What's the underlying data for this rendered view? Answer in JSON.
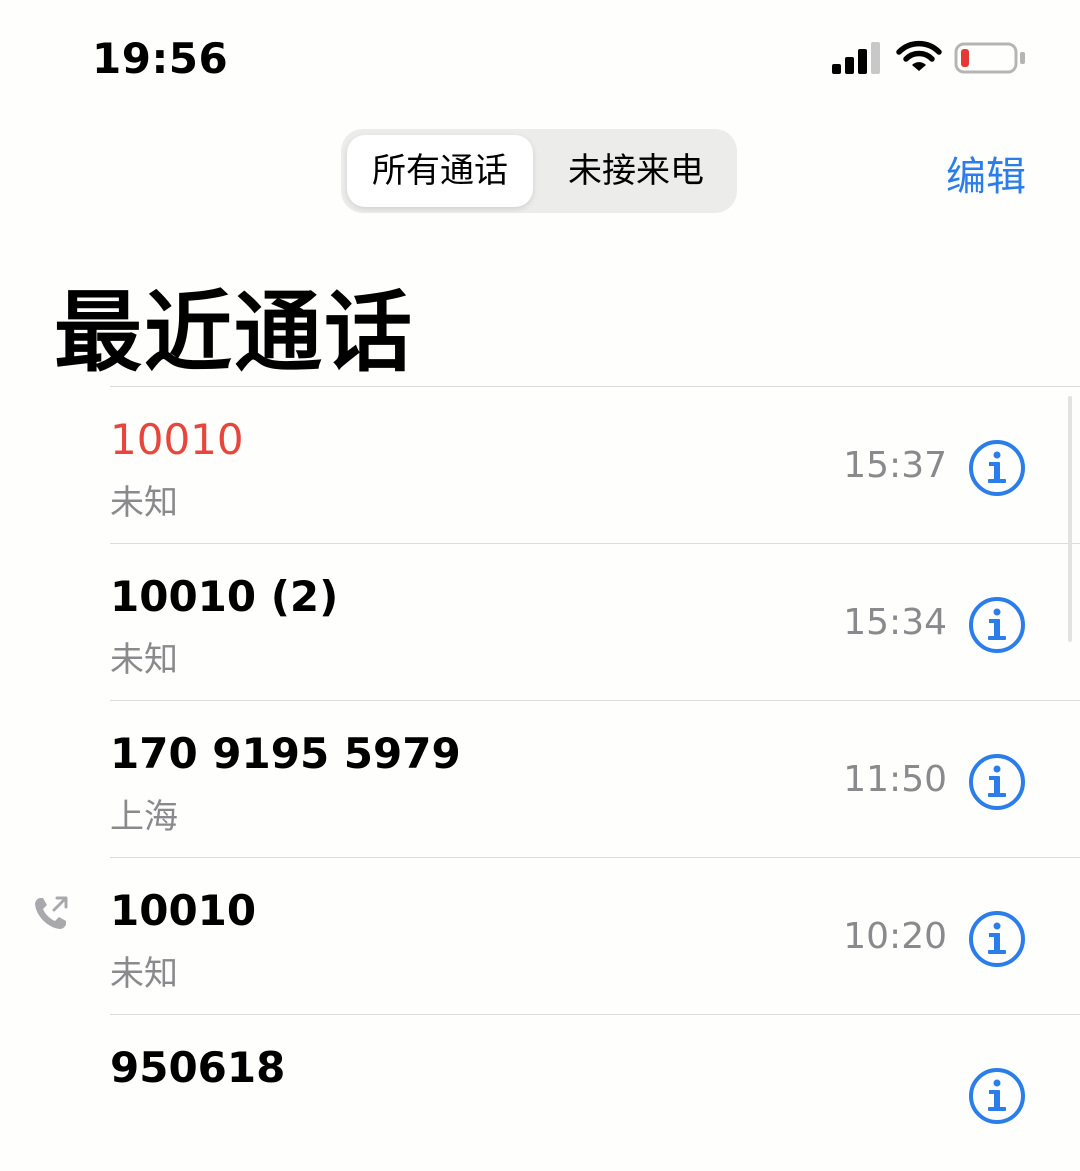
{
  "status_bar": {
    "time": "19:56",
    "battery_color": "#e53935"
  },
  "segment": {
    "all_calls": "所有通话",
    "missed_calls": "未接来电",
    "selected": "all_calls"
  },
  "edit_label": "编辑",
  "title": "最近通话",
  "accent_color": "#2b7de9",
  "missed_color": "#e8453c",
  "calls": [
    {
      "name": "10010",
      "sub": "未知",
      "time": "15:37",
      "missed": true,
      "outgoing": false
    },
    {
      "name": "10010 (2)",
      "sub": "未知",
      "time": "15:34",
      "missed": false,
      "outgoing": false
    },
    {
      "name": "170 9195 5979",
      "sub": "上海",
      "time": "11:50",
      "missed": false,
      "outgoing": false
    },
    {
      "name": "10010",
      "sub": "未知",
      "time": "10:20",
      "missed": false,
      "outgoing": true
    },
    {
      "name": "950618",
      "sub": "",
      "time": "",
      "missed": false,
      "outgoing": false
    }
  ]
}
